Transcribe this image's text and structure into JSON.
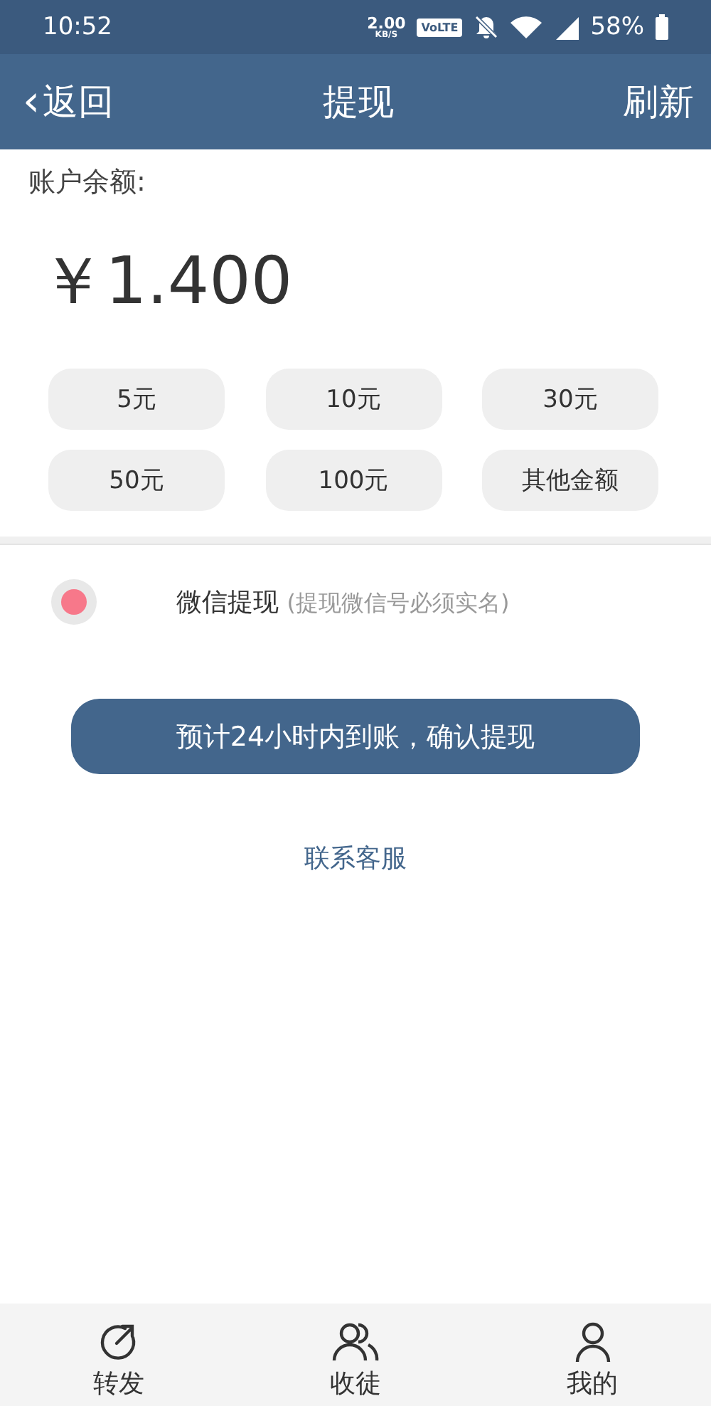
{
  "status_bar": {
    "time": "10:52",
    "speed": "2.00",
    "speed_unit": "KB/S",
    "network_badge": "VoLTE",
    "battery": "58%"
  },
  "nav_bar": {
    "back": "返回",
    "back_arrow": "‹",
    "title": "提现",
    "action": "刷新"
  },
  "balance": {
    "label": "账户余额:",
    "amount": "￥1.400"
  },
  "amounts": [
    {
      "label": "5元",
      "selected": false
    },
    {
      "label": "10元",
      "selected": false
    },
    {
      "label": "30元",
      "selected": false
    },
    {
      "label": "50元",
      "selected": false
    },
    {
      "label": "100元",
      "selected": false
    },
    {
      "label": "其他金额",
      "selected": false
    }
  ],
  "methods": [
    {
      "label": "微信提现",
      "note": "(提现微信号必须实名)",
      "selected": true
    }
  ],
  "confirm_button": "预计24小时内到账，确认提现",
  "contact_link": "联系客服",
  "tab_bar": [
    {
      "label": "转发"
    },
    {
      "label": "收徒"
    },
    {
      "label": "我的"
    }
  ]
}
